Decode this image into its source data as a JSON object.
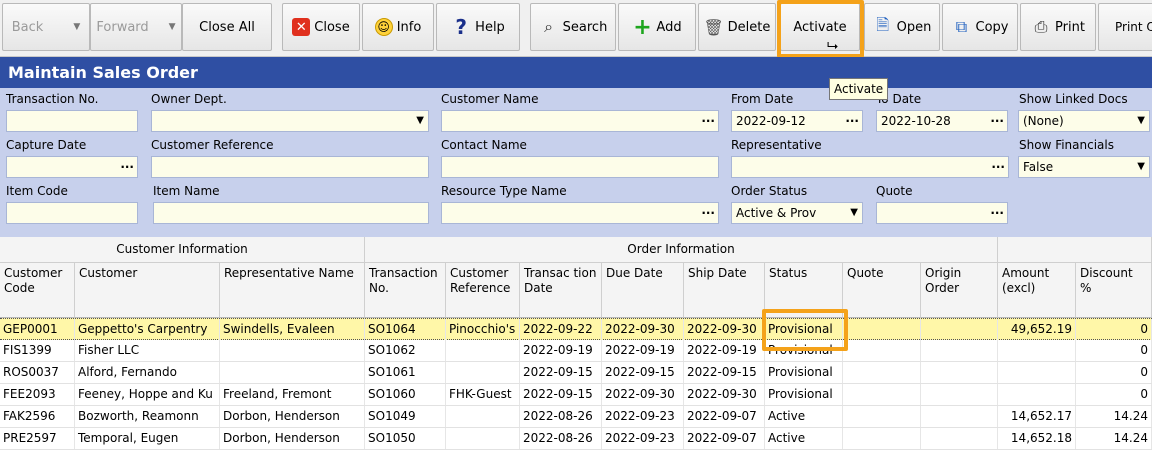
{
  "toolbar": {
    "back": "Back",
    "forward": "Forward",
    "close_all": "Close All",
    "close": "Close",
    "info": "Info",
    "help": "Help",
    "search": "Search",
    "add": "Add",
    "delete": "Delete",
    "activate": "Activate",
    "open": "Open",
    "copy": "Copy",
    "print": "Print",
    "print_options": "Print Option"
  },
  "tooltip": "Activate",
  "title": "Maintain Sales Order",
  "filters": {
    "transaction_no": {
      "label": "Transaction No.",
      "value": ""
    },
    "owner_dept": {
      "label": "Owner Dept.",
      "value": ""
    },
    "customer_name": {
      "label": "Customer Name",
      "value": ""
    },
    "from_date": {
      "label": "From Date",
      "value": "2022-09-12"
    },
    "to_date": {
      "label": "To Date",
      "value": "2022-10-28"
    },
    "show_linked_docs": {
      "label": "Show Linked Docs",
      "value": "(None)"
    },
    "capture_date": {
      "label": "Capture Date",
      "value": ""
    },
    "customer_reference": {
      "label": "Customer Reference",
      "value": ""
    },
    "contact_name": {
      "label": "Contact Name",
      "value": ""
    },
    "representative": {
      "label": "Representative",
      "value": ""
    },
    "show_financials": {
      "label": "Show Financials",
      "value": "False"
    },
    "item_code": {
      "label": "Item Code",
      "value": ""
    },
    "item_name": {
      "label": "Item Name",
      "value": ""
    },
    "resource_type_name": {
      "label": "Resource Type Name",
      "value": ""
    },
    "order_status": {
      "label": "Order Status",
      "value": "Active & Prov"
    },
    "quote": {
      "label": "Quote",
      "value": ""
    }
  },
  "grid": {
    "groups": [
      "Customer Information",
      "Order Information"
    ],
    "columns": [
      "Customer Code",
      "Customer",
      "Representative Name",
      "Transaction No.",
      "Customer Reference",
      "Transac tion Date",
      "Due Date",
      "Ship Date",
      "Status",
      "Quote",
      "Origin Order",
      "Amount (excl)",
      "Discount %"
    ],
    "rows": [
      [
        "GEP0001",
        "Geppetto's Carpentry",
        "Swindells, Evaleen",
        "SO1064",
        "Pinocchio's",
        "2022-09-22",
        "2022-09-30",
        "2022-09-30",
        "Provisional",
        "",
        "",
        "49,652.19",
        "0"
      ],
      [
        "FIS1399",
        "Fisher LLC",
        "",
        "SO1062",
        "",
        "2022-09-19",
        "2022-09-19",
        "2022-09-19",
        "Provisional",
        "",
        "",
        "",
        "0"
      ],
      [
        "ROS0037",
        "Alford, Fernando",
        "",
        "SO1061",
        "",
        "2022-09-15",
        "2022-09-15",
        "2022-09-15",
        "Provisional",
        "",
        "",
        "",
        "0"
      ],
      [
        "FEE2093",
        "Feeney, Hoppe and Ku",
        "Freeland, Fremont",
        "SO1060",
        "FHK-Guest",
        "2022-09-15",
        "2022-09-30",
        "2022-09-30",
        "Provisional",
        "",
        "",
        "",
        "0"
      ],
      [
        "FAK2596",
        "Bozworth, Reamonn",
        "Dorbon, Henderson",
        "SO1049",
        "",
        "2022-08-26",
        "2022-09-23",
        "2022-09-07",
        "Active",
        "",
        "",
        "14,652.17",
        "14.24"
      ],
      [
        "PRE2597",
        "Temporal, Eugen",
        "Dorbon, Henderson",
        "SO1050",
        "",
        "2022-08-26",
        "2022-09-23",
        "2022-09-07",
        "Active",
        "",
        "",
        "14,652.18",
        "14.24"
      ]
    ]
  }
}
